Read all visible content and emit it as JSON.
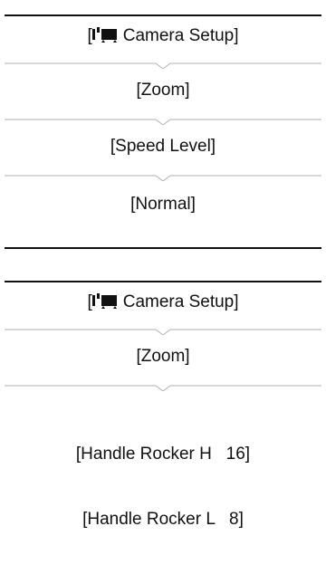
{
  "menu_paths": [
    {
      "steps": [
        {
          "type": "menu",
          "icon": "movie-camera-icon",
          "label": "Camera Setup"
        },
        {
          "type": "text",
          "label": "[Zoom]"
        },
        {
          "type": "text",
          "label": "[Speed Level]"
        },
        {
          "type": "text",
          "label": "[Normal]"
        }
      ]
    },
    {
      "steps": [
        {
          "type": "menu",
          "icon": "movie-camera-icon",
          "label": "Camera Setup"
        },
        {
          "type": "text",
          "label": "[Zoom]"
        },
        {
          "type": "multi",
          "lines": [
            "[Handle Rocker H   16]",
            "[Handle Rocker L   8]"
          ]
        }
      ]
    }
  ],
  "colors": {
    "text": "#111111",
    "separator": "#b0b0b0",
    "rule": "#111111"
  }
}
